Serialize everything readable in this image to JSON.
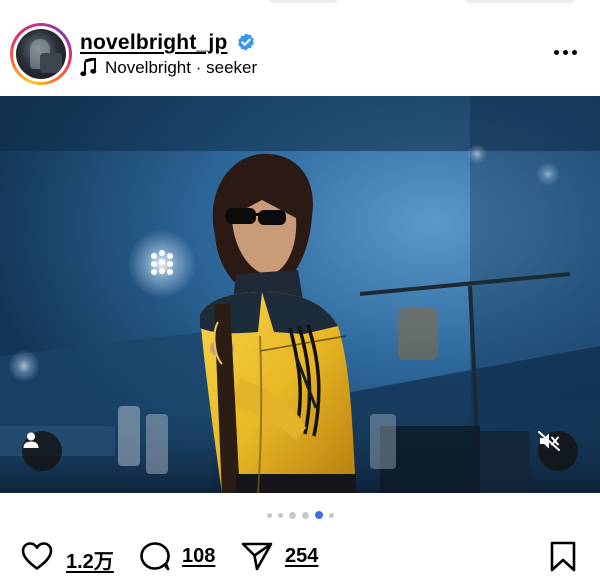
{
  "post_header": {
    "username": "novelbright_jp",
    "audio_artist": "Novelbright",
    "audio_separator": " · ",
    "audio_track": "seeker",
    "audio_icon": "music-note-icon",
    "verified_icon": "verified-badge-icon",
    "more_icon": "more-options-icon"
  },
  "media": {
    "user_tag_icon": "person-icon",
    "mute_icon": "speaker-muted-icon",
    "carousel_total": 6,
    "carousel_active_index": 4
  },
  "actions": {
    "like_icon": "heart-icon",
    "likes_count": "1.2万",
    "comment_icon": "comment-bubble-icon",
    "comments_count": "108",
    "share_icon": "send-icon",
    "shares_count": "254",
    "save_icon": "bookmark-icon"
  },
  "colors": {
    "carousel_active": "#3d6ee6",
    "verified": "#3897f0",
    "overlay_button": "#141414"
  }
}
